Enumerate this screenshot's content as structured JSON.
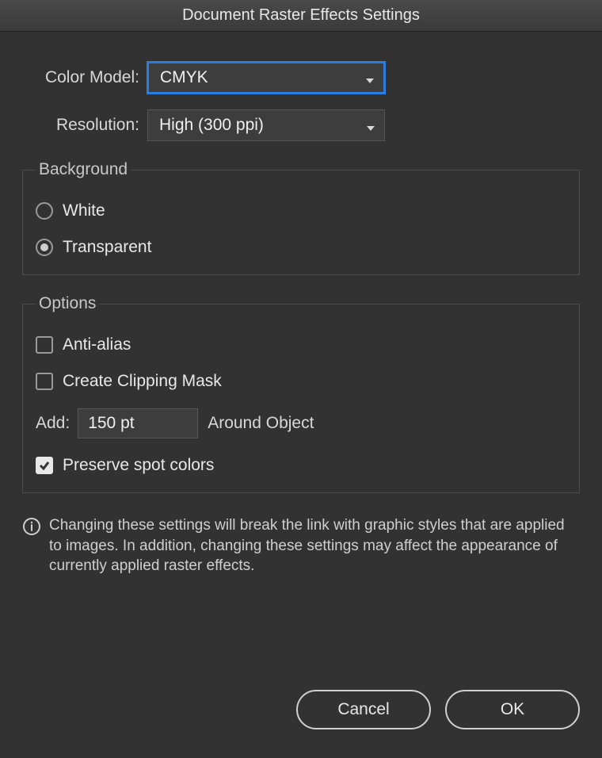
{
  "title": "Document Raster Effects Settings",
  "fields": {
    "color_model_label": "Color Model:",
    "color_model_value": "CMYK",
    "resolution_label": "Resolution:",
    "resolution_value": "High (300 ppi)"
  },
  "background": {
    "legend": "Background",
    "options": {
      "white": "White",
      "transparent": "Transparent"
    },
    "selected": "transparent"
  },
  "options": {
    "legend": "Options",
    "anti_alias": {
      "label": "Anti-alias",
      "checked": false
    },
    "clipping_mask": {
      "label": "Create Clipping Mask",
      "checked": false
    },
    "add": {
      "label": "Add:",
      "value": "150 pt",
      "suffix": "Around Object"
    },
    "preserve_spot": {
      "label": "Preserve spot colors",
      "checked": true
    }
  },
  "info_text": "Changing these settings will break the link with graphic styles that are applied to images. In addition, changing these settings may affect the appearance of currently applied raster effects.",
  "buttons": {
    "cancel": "Cancel",
    "ok": "OK"
  }
}
